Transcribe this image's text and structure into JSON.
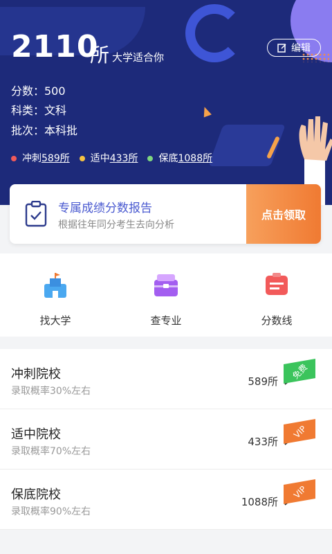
{
  "header": {
    "count": "2110",
    "count_suffix": "所",
    "subtitle": "大学适合你",
    "edit_label": "编辑",
    "score_label": "分数：500",
    "subject_label": "科类：文科",
    "batch_label": "批次：本科批"
  },
  "legend": [
    {
      "label": "冲刺",
      "value": "589所",
      "color": "#f05a5a"
    },
    {
      "label": "适中",
      "value": "433所",
      "color": "#f5c242"
    },
    {
      "label": "保底",
      "value": "1088所",
      "color": "#7fd67f"
    }
  ],
  "report": {
    "title": "专属成绩分数报告",
    "desc": "根据往年同分考生去向分析",
    "cta": "点击领取"
  },
  "nav": [
    {
      "label": "找大学",
      "icon": "school-icon"
    },
    {
      "label": "查专业",
      "icon": "toolbox-icon"
    },
    {
      "label": "分数线",
      "icon": "document-icon"
    }
  ],
  "tiers": [
    {
      "name": "冲刺院校",
      "rate": "录取概率30%左右",
      "count": "589所",
      "tag": "免费",
      "tag_color": "#3bc45c"
    },
    {
      "name": "适中院校",
      "rate": "录取概率70%左右",
      "count": "433所",
      "tag": "VIP",
      "tag_color": "#f07a32"
    },
    {
      "name": "保底院校",
      "rate": "录取概率90%左右",
      "count": "1088所",
      "tag": "VIP",
      "tag_color": "#f07a32"
    }
  ]
}
